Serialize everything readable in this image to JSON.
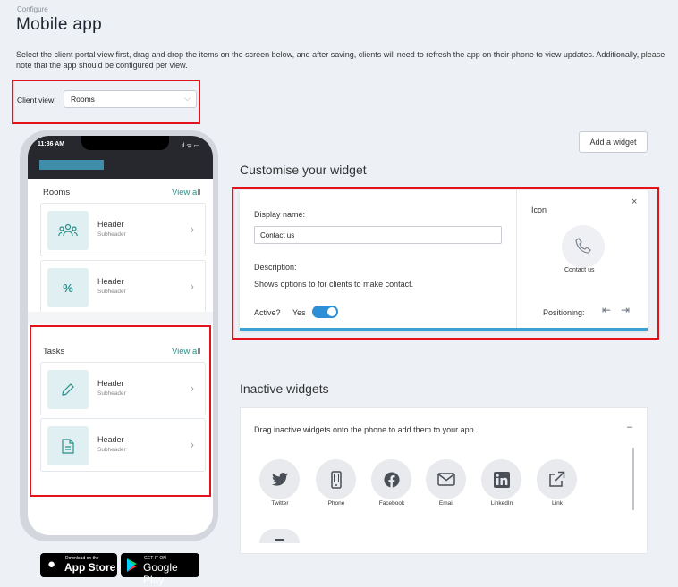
{
  "header": {
    "breadcrumb": "Configure",
    "title": "Mobile app",
    "intro": "Select the client portal view first, drag and drop the items on the screen below, and after saving, clients will need to refresh the app on their phone to view updates. Additionally, please note that the app should be configured per view."
  },
  "client_view": {
    "label": "Client view:",
    "value": "Rooms"
  },
  "phone": {
    "time": "11:36 AM",
    "status_icons": ".ıl ᯤ ▭",
    "rooms": {
      "title": "Rooms",
      "view_all": "View all",
      "cards": [
        {
          "header": "Header",
          "subheader": "Subheader",
          "icon": "people-icon"
        },
        {
          "header": "Header",
          "subheader": "Subheader",
          "icon": "percent-icon"
        }
      ]
    },
    "tasks": {
      "title": "Tasks",
      "view_all": "View all",
      "cards": [
        {
          "header": "Header",
          "subheader": "Subheader",
          "icon": "pencil-icon"
        },
        {
          "header": "Header",
          "subheader": "Subheader",
          "icon": "document-icon"
        }
      ]
    }
  },
  "stores": {
    "apple_small": "Download on the",
    "apple_big": "App Store",
    "google_small": "GET IT ON",
    "google_big": "Google Play"
  },
  "add_widget_label": "Add a widget",
  "customise": {
    "heading": "Customise your widget",
    "display_name_label": "Display name:",
    "display_name_value": "Contact us",
    "description_label": "Description:",
    "description_text": "Shows options to for clients to make contact.",
    "active_label": "Active?",
    "active_value": "Yes",
    "icon_label": "Icon",
    "icon_name": "Contact us",
    "icon": "phone-icon",
    "positioning_label": "Positioning:",
    "close": "×"
  },
  "inactive": {
    "heading": "Inactive widgets",
    "hint": "Drag inactive widgets onto the phone to add them to your app.",
    "collapse": "–",
    "widgets": [
      {
        "label": "Twitter",
        "icon": "twitter-icon"
      },
      {
        "label": "Phone",
        "icon": "mobile-phone-icon"
      },
      {
        "label": "Facebook",
        "icon": "facebook-icon"
      },
      {
        "label": "Email",
        "icon": "email-icon"
      },
      {
        "label": "LinkedIn",
        "icon": "linkedin-icon"
      },
      {
        "label": "Link",
        "icon": "external-link-icon"
      }
    ]
  },
  "colors": {
    "accent": "#2d8fd5",
    "highlight": "#e4121a",
    "teal": "#2a8f8a"
  }
}
